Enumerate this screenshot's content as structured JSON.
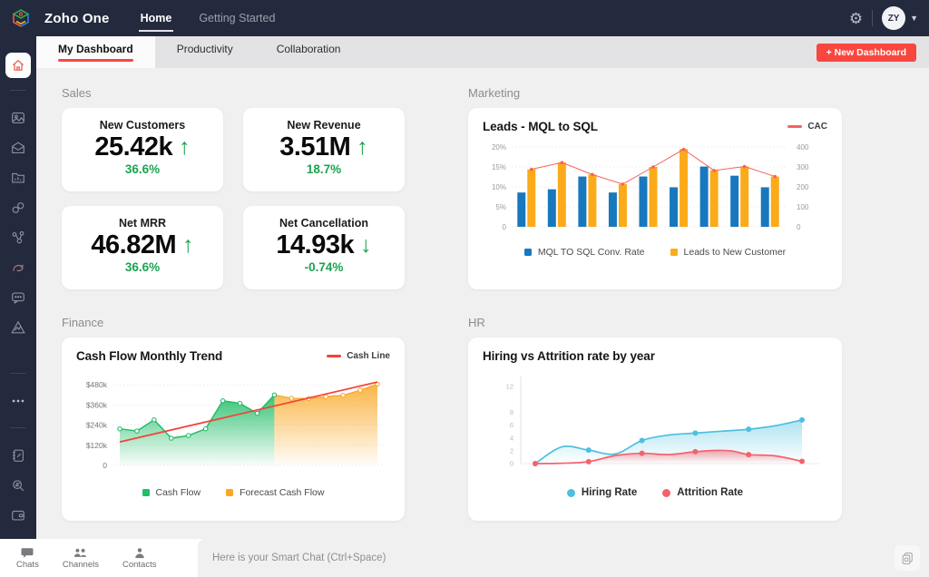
{
  "topbar": {
    "brand": "Zoho One",
    "nav": [
      {
        "label": "Home",
        "active": true
      },
      {
        "label": "Getting Started",
        "active": false
      }
    ],
    "avatar_initials": "ZY"
  },
  "tabbar": {
    "tabs": [
      {
        "label": "My Dashboard",
        "active": true
      },
      {
        "label": "Productivity",
        "active": false
      },
      {
        "label": "Collaboration",
        "active": false
      }
    ],
    "new_dashboard": "+ New Dashboard"
  },
  "sidebar": {
    "icons": [
      "home",
      "gallery",
      "mail",
      "reports-folder",
      "link",
      "network",
      "sprints",
      "chat",
      "analytics",
      "more",
      "notebook",
      "search",
      "wallet"
    ]
  },
  "sections": {
    "sales": {
      "label": "Sales",
      "cards": [
        {
          "title": "New Customers",
          "value": "25.42k",
          "arrow": "↑",
          "change": "36.6%"
        },
        {
          "title": "New Revenue",
          "value": "3.51M",
          "arrow": "↑",
          "change": "18.7%"
        },
        {
          "title": "Net MRR",
          "value": "46.82M",
          "arrow": "↑",
          "change": "36.6%"
        },
        {
          "title": "Net Cancellation",
          "value": "14.93k",
          "arrow": "↓",
          "change": "-0.74%"
        }
      ]
    },
    "marketing": {
      "label": "Marketing"
    },
    "finance": {
      "label": "Finance"
    },
    "hr": {
      "label": "HR"
    }
  },
  "chart_data": [
    {
      "id": "marketing",
      "type": "bar",
      "title": "Leads - MQL to SQL",
      "left_axis": {
        "max": 20,
        "ticks": [
          {
            "label": "0",
            "v": 0
          },
          {
            "label": "5%",
            "v": 5
          },
          {
            "label": "10%",
            "v": 10
          },
          {
            "label": "15%",
            "v": 15
          },
          {
            "label": "20%",
            "v": 20
          }
        ]
      },
      "right_axis": {
        "max": 400,
        "ticks": [
          {
            "label": "0",
            "v": 0
          },
          {
            "label": "100",
            "v": 100
          },
          {
            "label": "200",
            "v": 200
          },
          {
            "label": "300",
            "v": 300
          },
          {
            "label": "400",
            "v": 400
          }
        ]
      },
      "series": [
        {
          "name": "MQL TO SQL Conv. Rate",
          "color": "#1878be",
          "values": [
            8.6,
            9.4,
            12.6,
            8.6,
            12.6,
            9.9,
            15.1,
            12.8,
            9.9
          ]
        },
        {
          "name": "Leads to New Customer",
          "color": "#fbab1a",
          "values": [
            14.4,
            16.1,
            13.1,
            10.7,
            15.0,
            19.5,
            14.2,
            15.1,
            12.6
          ]
        }
      ],
      "line": {
        "name": "CAC",
        "color": "#f4635c",
        "values": [
          288,
          322,
          262,
          214,
          300,
          388,
          282,
          302,
          252
        ]
      }
    },
    {
      "id": "finance",
      "type": "area",
      "title": "Cash Flow Monthly Trend",
      "y_max": 530,
      "y_ticks": [
        {
          "label": "0",
          "v": 0
        },
        {
          "label": "$120k",
          "v": 120
        },
        {
          "label": "$240k",
          "v": 240
        },
        {
          "label": "$360k",
          "v": 360
        },
        {
          "label": "$480k",
          "v": 480
        }
      ],
      "cash_flow": {
        "name": "Cash Flow",
        "color": "#22bd68",
        "values": [
          218,
          205,
          272,
          162,
          178,
          218,
          385,
          370,
          310,
          420
        ]
      },
      "forecast": {
        "name": "Forecast Cash Flow",
        "color": "#f9a825",
        "values": [
          420,
          400,
          398,
          410,
          418,
          448,
          485
        ]
      },
      "trend": {
        "name": "Cash Line",
        "color": "#f4433c",
        "start": 140,
        "end": 497
      }
    },
    {
      "id": "hr",
      "type": "line",
      "title": "Hiring vs Attrition rate by year",
      "y_max": 13,
      "y_ticks": [
        {
          "label": "0",
          "v": 0
        },
        {
          "label": "2",
          "v": 2
        },
        {
          "label": "4",
          "v": 4
        },
        {
          "label": "6",
          "v": 6
        },
        {
          "label": "8",
          "v": 8
        },
        {
          "label": "12",
          "v": 12
        }
      ],
      "series": [
        {
          "name": "Hiring Rate",
          "color": "#4cc0e0",
          "points": [
            0,
            2.1,
            3.6,
            4.75,
            5.35,
            6.8
          ],
          "curve": [
            [
              0,
              0
            ],
            [
              0.5,
              2.6
            ],
            [
              1,
              2.1
            ],
            [
              1.5,
              1.5
            ],
            [
              2,
              3.6
            ],
            [
              2.5,
              4.45
            ],
            [
              3,
              4.75
            ],
            [
              3.5,
              5.05
            ],
            [
              4,
              5.35
            ],
            [
              4.5,
              5.9
            ],
            [
              5,
              6.8
            ]
          ]
        },
        {
          "name": "Attrition Rate",
          "color": "#f4626e",
          "points": [
            0,
            0.3,
            1.6,
            1.85,
            1.4,
            0.35
          ],
          "curve": [
            [
              0,
              0
            ],
            [
              0.5,
              0.05
            ],
            [
              1,
              0.3
            ],
            [
              1.5,
              1.25
            ],
            [
              2,
              1.6
            ],
            [
              2.5,
              1.4
            ],
            [
              3,
              1.85
            ],
            [
              3.4,
              2.05
            ],
            [
              3.7,
              1.95
            ],
            [
              4,
              1.4
            ],
            [
              4.5,
              1.2
            ],
            [
              5,
              0.35
            ]
          ]
        }
      ]
    }
  ],
  "bottombar": {
    "tabs": [
      {
        "label": "Chats",
        "icon": "chat-bubble"
      },
      {
        "label": "Channels",
        "icon": "people-group"
      },
      {
        "label": "Contacts",
        "icon": "person"
      }
    ],
    "smart_chat_placeholder": "Here is your Smart Chat (Ctrl+Space)"
  },
  "colors": {
    "topbar_bg": "#232a3d",
    "accent_red": "#f8473f",
    "kpi_green": "#1ca350",
    "bar_blue": "#1878be",
    "bar_yellow": "#fbab1a",
    "cac_red": "#f4635c",
    "area_green": "#22bd68",
    "area_orange": "#f9a825",
    "hr_cyan": "#4cc0e0",
    "hr_red": "#f4626e"
  }
}
